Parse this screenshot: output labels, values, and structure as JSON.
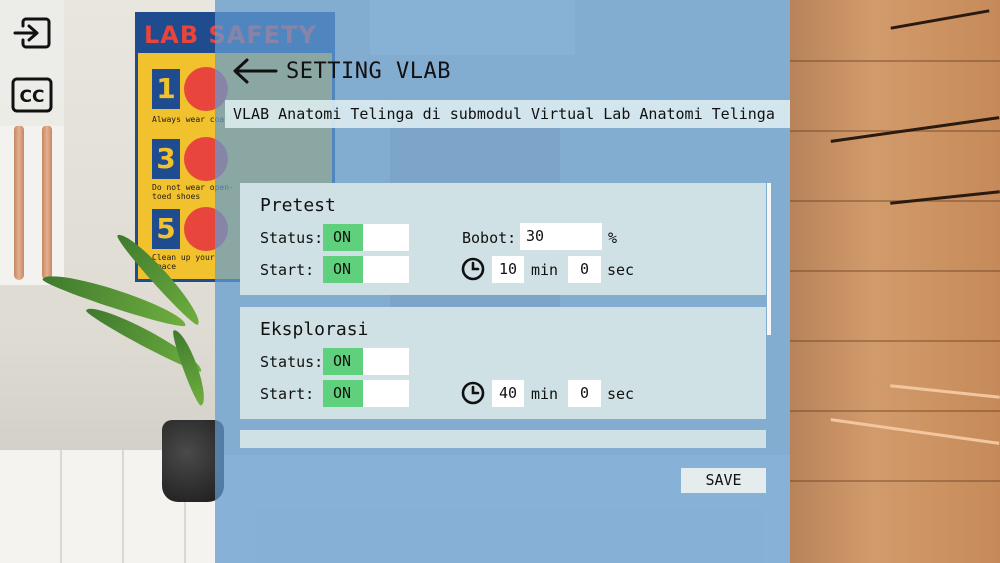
{
  "toolbar": {
    "exit_icon": "exit-icon",
    "cc_icon": "cc-icon",
    "cc_label": "CC"
  },
  "background": {
    "poster_title": "LAB SAFETY",
    "poster_items": [
      {
        "number": "1",
        "text": "Always wear coat"
      },
      {
        "number": "3",
        "text": "Do not wear open-toed shoes"
      },
      {
        "number": "5",
        "text": "Clean up your space"
      }
    ]
  },
  "header": {
    "back_icon": "arrow-left-icon",
    "title": "SETTING VLAB"
  },
  "subtitle": "VLAB Anatomi Telinga di submodul Virtual Lab Anatomi Telinga",
  "sections": [
    {
      "title": "Pretest",
      "status_label": "Status:",
      "status_value": "ON",
      "start_label": "Start:",
      "start_value": "ON",
      "bobot_label": "Bobot:",
      "bobot_value": "30",
      "bobot_unit": "%",
      "time_icon": "clock-icon",
      "minutes": "10",
      "min_label": "min",
      "seconds": "0",
      "sec_label": "sec"
    },
    {
      "title": "Eksplorasi",
      "status_label": "Status:",
      "status_value": "ON",
      "start_label": "Start:",
      "start_value": "ON",
      "time_icon": "clock-icon",
      "minutes": "40",
      "min_label": "min",
      "seconds": "0",
      "sec_label": "sec"
    }
  ],
  "save_label": "SAVE",
  "colors": {
    "toggle_on": "#5fd17c",
    "overlay_blue": "#629cd2",
    "card_bg": "#cfe1e4"
  }
}
